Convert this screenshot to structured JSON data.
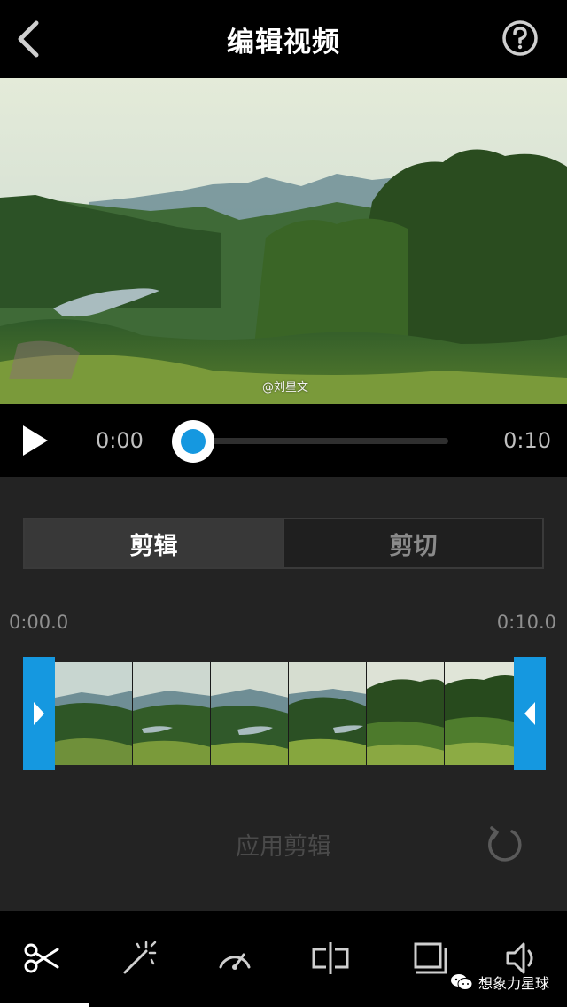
{
  "header": {
    "title": "编辑视频",
    "back_icon": "chevron-left-icon",
    "help_icon": "help-circle-icon"
  },
  "preview": {
    "watermark": "@刘星文"
  },
  "playback": {
    "current_time": "0:00",
    "total_time": "0:10",
    "progress": 0,
    "accent_color": "#1598e0"
  },
  "editor": {
    "tabs": [
      {
        "label": "剪辑",
        "active": true
      },
      {
        "label": "剪切",
        "active": false
      }
    ],
    "trim_start": "0:00.0",
    "trim_end": "0:10.0",
    "apply_label": "应用剪辑",
    "reset_icon": "reset-icon"
  },
  "toolbar": {
    "items": [
      {
        "icon": "scissors-icon",
        "active": true
      },
      {
        "icon": "magic-wand-icon",
        "active": false
      },
      {
        "icon": "speed-gauge-icon",
        "active": false
      },
      {
        "icon": "split-icon",
        "active": false
      },
      {
        "icon": "crop-frame-icon",
        "active": false
      },
      {
        "icon": "volume-icon",
        "active": false
      }
    ],
    "wechat_label": "想象力星球"
  }
}
